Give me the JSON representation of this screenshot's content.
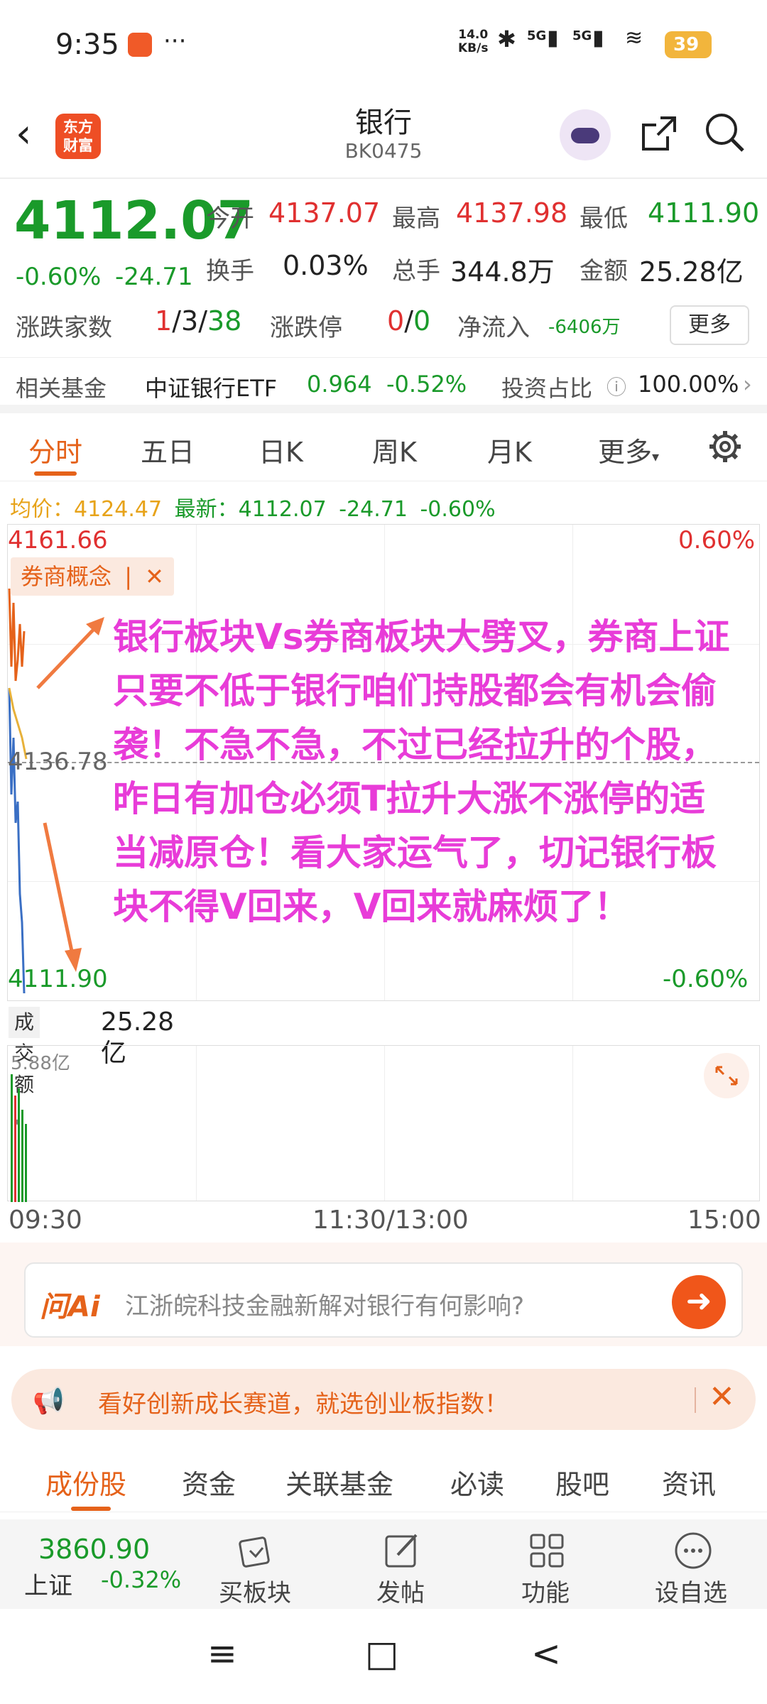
{
  "status": {
    "time": "9:35",
    "more": "···",
    "net_speed_value": "14.0",
    "net_speed_unit": "KB/s",
    "sig1": "5G",
    "sig2": "5G",
    "battery": "39"
  },
  "header": {
    "logo_line1": "东方",
    "logo_line2": "财富",
    "title": "银行",
    "code": "BK0475"
  },
  "quote": {
    "price": "4112.07",
    "change_pct": "-0.60%",
    "change": "-24.71",
    "open_label": "今开",
    "open": "4137.07",
    "high_label": "最高",
    "high": "4137.98",
    "low_label": "最低",
    "low": "4111.90",
    "turnover_label": "换手",
    "turnover": "0.03%",
    "volume_label": "总手",
    "volume": "344.8万",
    "amount_label": "金额",
    "amount": "25.28亿",
    "updown_label": "涨跌家数",
    "up": "1",
    "flat": "3",
    "down": "38",
    "slash": "/",
    "limit_label": "涨跌停",
    "limit_up": "0",
    "limit_down": "0",
    "inflow_label": "净流入",
    "inflow": "-6406万",
    "more": "更多"
  },
  "fund": {
    "label": "相关基金",
    "name": "中证银行ETF",
    "price": "0.964",
    "change": "-0.52%",
    "ratio_label": "投资占比",
    "ratio": "100.00%"
  },
  "tabs": [
    "分时",
    "五日",
    "日K",
    "周K",
    "月K",
    "更多"
  ],
  "avg": {
    "avg_label": "均价：",
    "avg_value": "4124.47",
    "latest_label": "最新：",
    "latest_value": "4112.07",
    "change": "-24.71",
    "change_pct": "-0.60%"
  },
  "chart": {
    "y_top": "4161.66",
    "y_mid": "4136.78",
    "y_bottom": "4111.90",
    "pct_top": "0.60%",
    "pct_bottom": "-0.60%",
    "tag": "券商概念",
    "annotation": "银行板块Vs券商板块大劈叉，券商上证只要不低于银行咱们持股都会有机会偷袭！不急不急，不过已经拉升的个股，昨日有加仓必须T拉升大涨不涨停的适当减原仓！看大家运气了，切记银行板块不得V回来，V回来就麻烦了！",
    "colors": {
      "orange": "#e5621a",
      "blue": "#3a6fc4",
      "yellow": "#e7b13a",
      "annotation": "#e83cd8"
    }
  },
  "volume": {
    "selector": "成交额",
    "value": "25.28亿",
    "max": "5.88亿",
    "t_start": "09:30",
    "t_mid": "11:30/13:00",
    "t_end": "15:00"
  },
  "ai": {
    "logo": "问Ai",
    "question": "江浙皖科技金融新解对银行有何影响?"
  },
  "banner": {
    "text": "看好创新成长赛道，就选创业板指数！"
  },
  "subtabs": [
    "成份股",
    "资金",
    "关联基金",
    "必读",
    "股吧",
    "资讯"
  ],
  "toolbar": {
    "index_value": "3860.90",
    "index_name": "上证",
    "index_change": "-0.32%",
    "buy": "买板块",
    "post": "发帖",
    "func": "功能",
    "watch": "设自选"
  },
  "navbar": {
    "menu": "≡",
    "home": "□",
    "back": "<"
  }
}
